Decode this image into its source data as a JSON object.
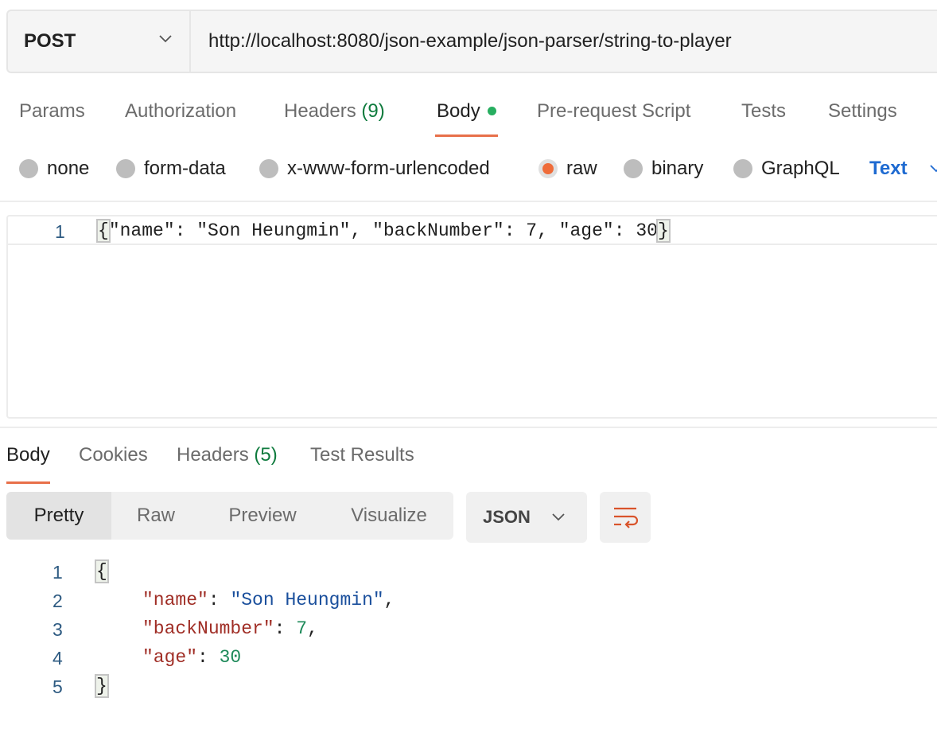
{
  "request": {
    "method": "POST",
    "url": "http://localhost:8080/json-example/json-parser/string-to-player"
  },
  "request_tabs": [
    {
      "label": "Params"
    },
    {
      "label": "Authorization"
    },
    {
      "label": "Headers ",
      "count": "(9)"
    },
    {
      "label": "Body"
    },
    {
      "label": "Pre-request Script"
    },
    {
      "label": "Tests"
    },
    {
      "label": "Settings"
    }
  ],
  "body_types": [
    {
      "label": "none"
    },
    {
      "label": "form-data"
    },
    {
      "label": "x-www-form-urlencoded"
    },
    {
      "label": "raw"
    },
    {
      "label": "binary"
    },
    {
      "label": "GraphQL"
    }
  ],
  "raw_format": "Text",
  "request_body": {
    "line_number": "1",
    "open_brace": "{",
    "content": "\"name\": \"Son Heungmin\", \"backNumber\": 7, \"age\": 30",
    "close_brace": "}"
  },
  "response_tabs": [
    {
      "label": "Body"
    },
    {
      "label": "Cookies"
    },
    {
      "label": "Headers ",
      "count": "(5)"
    },
    {
      "label": "Test Results"
    }
  ],
  "view_modes": [
    "Pretty",
    "Raw",
    "Preview",
    "Visualize"
  ],
  "response_format": "JSON",
  "response_body": {
    "line_numbers": [
      "1",
      "2",
      "3",
      "4",
      "5"
    ],
    "open_brace": "{",
    "close_brace": "}",
    "fields": [
      {
        "key": "\"name\"",
        "value": "\"Son Heungmin\"",
        "type": "string",
        "trail": ","
      },
      {
        "key": "\"backNumber\"",
        "value": "7",
        "type": "number",
        "trail": ","
      },
      {
        "key": "\"age\"",
        "value": "30",
        "type": "number",
        "trail": ""
      }
    ]
  },
  "colors": {
    "accent": "#e8704a",
    "count_green": "#0f7b3e",
    "text_link": "#1e6ad1",
    "json_key": "#a02e26",
    "json_string": "#1a4f9c",
    "json_number": "#1e8a5a"
  }
}
